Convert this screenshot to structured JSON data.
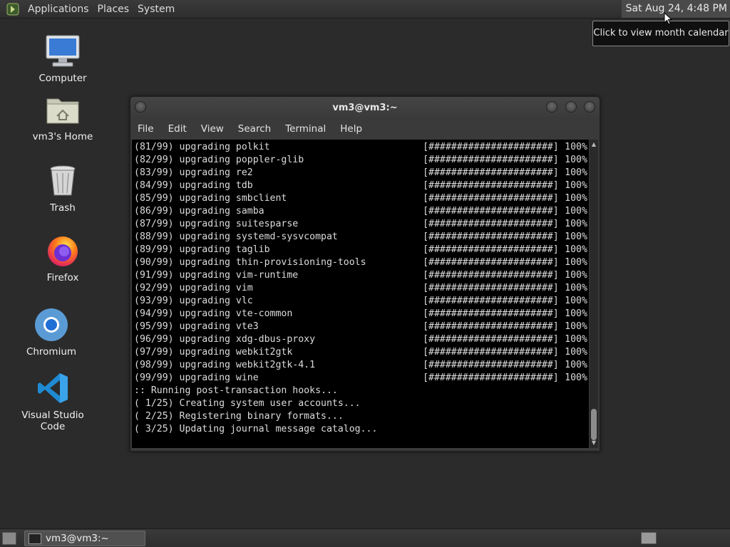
{
  "top_panel": {
    "menus": [
      "Applications",
      "Places",
      "System"
    ],
    "clock": "Sat Aug 24,  4:48 PM",
    "tooltip": "Click to view month calendar"
  },
  "desktop_icons": [
    {
      "label": "Computer",
      "icon": "computer-icon"
    },
    {
      "label": "vm3's Home",
      "icon": "home-folder-icon"
    },
    {
      "label": "Trash",
      "icon": "trash-icon"
    },
    {
      "label": "Firefox",
      "icon": "firefox-icon"
    },
    {
      "label": "Chromium",
      "icon": "chromium-icon"
    },
    {
      "label": "Visual Studio Code",
      "icon": "vscode-icon"
    }
  ],
  "window": {
    "title": "vm3@vm3:~",
    "menu": [
      "File",
      "Edit",
      "View",
      "Search",
      "Terminal",
      "Help"
    ],
    "progress_lines": [
      {
        "text": "(81/99) upgrading polkit",
        "bar": "[######################]",
        "pct": "100%"
      },
      {
        "text": "(82/99) upgrading poppler-glib",
        "bar": "[######################]",
        "pct": "100%"
      },
      {
        "text": "(83/99) upgrading re2",
        "bar": "[######################]",
        "pct": "100%"
      },
      {
        "text": "(84/99) upgrading tdb",
        "bar": "[######################]",
        "pct": "100%"
      },
      {
        "text": "(85/99) upgrading smbclient",
        "bar": "[######################]",
        "pct": "100%"
      },
      {
        "text": "(86/99) upgrading samba",
        "bar": "[######################]",
        "pct": "100%"
      },
      {
        "text": "(87/99) upgrading suitesparse",
        "bar": "[######################]",
        "pct": "100%"
      },
      {
        "text": "(88/99) upgrading systemd-sysvcompat",
        "bar": "[######################]",
        "pct": "100%"
      },
      {
        "text": "(89/99) upgrading taglib",
        "bar": "[######################]",
        "pct": "100%"
      },
      {
        "text": "(90/99) upgrading thin-provisioning-tools",
        "bar": "[######################]",
        "pct": "100%"
      },
      {
        "text": "(91/99) upgrading vim-runtime",
        "bar": "[######################]",
        "pct": "100%"
      },
      {
        "text": "(92/99) upgrading vim",
        "bar": "[######################]",
        "pct": "100%"
      },
      {
        "text": "(93/99) upgrading vlc",
        "bar": "[######################]",
        "pct": "100%"
      },
      {
        "text": "(94/99) upgrading vte-common",
        "bar": "[######################]",
        "pct": "100%"
      },
      {
        "text": "(95/99) upgrading vte3",
        "bar": "[######################]",
        "pct": "100%"
      },
      {
        "text": "(96/99) upgrading xdg-dbus-proxy",
        "bar": "[######################]",
        "pct": "100%"
      },
      {
        "text": "(97/99) upgrading webkit2gtk",
        "bar": "[######################]",
        "pct": "100%"
      },
      {
        "text": "(98/99) upgrading webkit2gtk-4.1",
        "bar": "[######################]",
        "pct": "100%"
      },
      {
        "text": "(99/99) upgrading wine",
        "bar": "[######################]",
        "pct": "100%"
      }
    ],
    "hook_lines": [
      ":: Running post-transaction hooks...",
      "( 1/25) Creating system user accounts...",
      "( 2/25) Registering binary formats...",
      "( 3/25) Updating journal message catalog..."
    ]
  },
  "taskbar": {
    "task_label": "vm3@vm3:~"
  }
}
